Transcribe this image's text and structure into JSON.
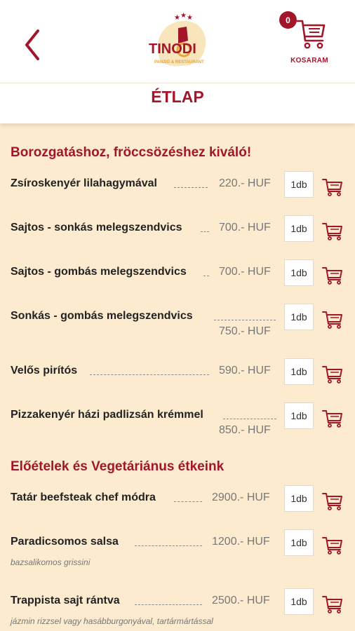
{
  "header": {
    "logo_text": "TINODI",
    "logo_subtext": "PANZIÓ & RESTAURANT",
    "cart_count": "0",
    "cart_label": "KOSARAM"
  },
  "page_title": "ÉTLAP",
  "sections": [
    {
      "title": "Borozgatáshoz, fröccsözéshez kiváló!",
      "items": [
        {
          "name": "Zsíroskenyér lilahagymával",
          "price": "220.- HUF",
          "qty": "1db"
        },
        {
          "name": "Sajtos - sonkás melegszendvics",
          "price": "700.- HUF",
          "qty": "1db"
        },
        {
          "name": "Sajtos - gombás melegszendvics",
          "price": "700.- HUF",
          "qty": "1db"
        },
        {
          "name": "Sonkás - gombás melegszendvics",
          "price": "750.- HUF",
          "qty": "1db"
        },
        {
          "name": "Velős pirítós",
          "price": "590.- HUF",
          "qty": "1db"
        },
        {
          "name": "Pizzakenyér házi padlizsán krémmel",
          "price": "850.- HUF",
          "qty": "1db"
        }
      ]
    },
    {
      "title": "Előételek és Vegetáriánus étkeink",
      "items": [
        {
          "name": "Tatár beefsteak chef módra",
          "price": "2900.- HUF",
          "qty": "1db"
        },
        {
          "name": "Paradicsomos salsa",
          "price": "1200.- HUF",
          "qty": "1db",
          "desc": "bazsalikomos grissini"
        },
        {
          "name": "Trappista sajt rántva",
          "price": "2500.- HUF",
          "qty": "1db",
          "desc": "jázmin rizzsel vagy hasábburgonyával, tartármártással"
        }
      ]
    }
  ],
  "colors": {
    "accent": "#a3162a",
    "background": "#fdebd0",
    "gold": "#e8a43a"
  }
}
